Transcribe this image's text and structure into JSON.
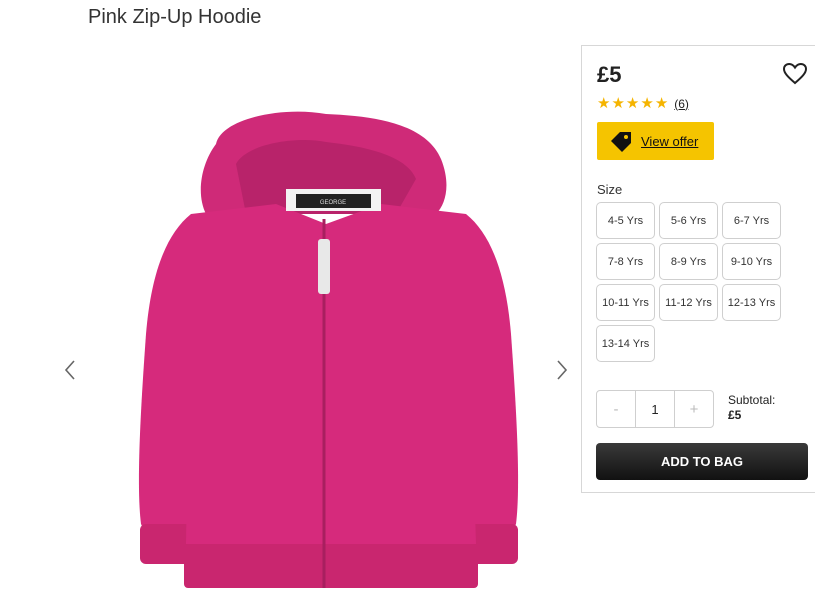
{
  "product": {
    "title": "Pink Zip-Up Hoodie",
    "image_label": "GEORGE"
  },
  "purchase": {
    "price": "£5",
    "rating_stars": 5,
    "review_count": "(6)",
    "offer_label": "View offer",
    "size_label": "Size",
    "sizes": [
      "4-5 Yrs",
      "5-6 Yrs",
      "6-7 Yrs",
      "7-8 Yrs",
      "8-9 Yrs",
      "9-10 Yrs",
      "10-11 Yrs",
      "11-12 Yrs",
      "12-13 Yrs",
      "13-14 Yrs"
    ],
    "quantity": {
      "minus": "-",
      "value": "1",
      "plus": "+"
    },
    "subtotal_label": "Subtotal:",
    "subtotal_value": "£5",
    "add_to_bag": "ADD TO BAG"
  },
  "icons": {
    "favourite": "heart-icon",
    "offer": "price-tag-icon",
    "prev": "chevron-left-icon",
    "next": "chevron-right-icon",
    "rating": "star-icon"
  },
  "colors": {
    "offer_bg": "#f5c400",
    "star": "#f5b400",
    "product": "#d62a7c",
    "button": "#1c1c1c"
  }
}
